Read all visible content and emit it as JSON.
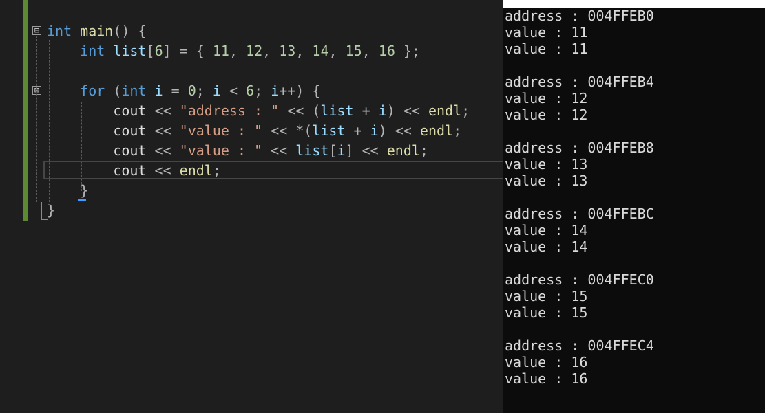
{
  "editor": {
    "lines": [
      {
        "tokens": [
          {
            "t": "int",
            "c": "kw"
          },
          {
            "t": " ",
            "c": "txt"
          },
          {
            "t": "main",
            "c": "fn"
          },
          {
            "t": "() {",
            "c": "pun"
          }
        ]
      },
      {
        "tokens": [
          {
            "t": "    ",
            "c": "txt"
          },
          {
            "t": "int",
            "c": "kw"
          },
          {
            "t": " ",
            "c": "txt"
          },
          {
            "t": "list",
            "c": "var"
          },
          {
            "t": "[",
            "c": "pun"
          },
          {
            "t": "6",
            "c": "num"
          },
          {
            "t": "] = { ",
            "c": "pun"
          },
          {
            "t": "11",
            "c": "num"
          },
          {
            "t": ", ",
            "c": "pun"
          },
          {
            "t": "12",
            "c": "num"
          },
          {
            "t": ", ",
            "c": "pun"
          },
          {
            "t": "13",
            "c": "num"
          },
          {
            "t": ", ",
            "c": "pun"
          },
          {
            "t": "14",
            "c": "num"
          },
          {
            "t": ", ",
            "c": "pun"
          },
          {
            "t": "15",
            "c": "num"
          },
          {
            "t": ", ",
            "c": "pun"
          },
          {
            "t": "16",
            "c": "num"
          },
          {
            "t": " };",
            "c": "pun"
          }
        ]
      },
      {
        "tokens": []
      },
      {
        "tokens": [
          {
            "t": "    ",
            "c": "txt"
          },
          {
            "t": "for",
            "c": "kw"
          },
          {
            "t": " (",
            "c": "pun"
          },
          {
            "t": "int",
            "c": "kw"
          },
          {
            "t": " ",
            "c": "txt"
          },
          {
            "t": "i",
            "c": "var"
          },
          {
            "t": " = ",
            "c": "pun"
          },
          {
            "t": "0",
            "c": "num"
          },
          {
            "t": "; ",
            "c": "pun"
          },
          {
            "t": "i",
            "c": "var"
          },
          {
            "t": " < ",
            "c": "pun"
          },
          {
            "t": "6",
            "c": "num"
          },
          {
            "t": "; ",
            "c": "pun"
          },
          {
            "t": "i",
            "c": "var"
          },
          {
            "t": "++) {",
            "c": "pun"
          }
        ]
      },
      {
        "tokens": [
          {
            "t": "        ",
            "c": "txt"
          },
          {
            "t": "cout",
            "c": "txt"
          },
          {
            "t": " << ",
            "c": "pun"
          },
          {
            "t": "\"address : \"",
            "c": "str"
          },
          {
            "t": " << (",
            "c": "pun"
          },
          {
            "t": "list",
            "c": "var"
          },
          {
            "t": " + ",
            "c": "pun"
          },
          {
            "t": "i",
            "c": "var"
          },
          {
            "t": ") << ",
            "c": "pun"
          },
          {
            "t": "endl",
            "c": "fn"
          },
          {
            "t": ";",
            "c": "pun"
          }
        ]
      },
      {
        "tokens": [
          {
            "t": "        ",
            "c": "txt"
          },
          {
            "t": "cout",
            "c": "txt"
          },
          {
            "t": " << ",
            "c": "pun"
          },
          {
            "t": "\"value : \"",
            "c": "str"
          },
          {
            "t": " << *(",
            "c": "pun"
          },
          {
            "t": "list",
            "c": "var"
          },
          {
            "t": " + ",
            "c": "pun"
          },
          {
            "t": "i",
            "c": "var"
          },
          {
            "t": ") << ",
            "c": "pun"
          },
          {
            "t": "endl",
            "c": "fn"
          },
          {
            "t": ";",
            "c": "pun"
          }
        ]
      },
      {
        "tokens": [
          {
            "t": "        ",
            "c": "txt"
          },
          {
            "t": "cout",
            "c": "txt"
          },
          {
            "t": " << ",
            "c": "pun"
          },
          {
            "t": "\"value : \"",
            "c": "str"
          },
          {
            "t": " << ",
            "c": "pun"
          },
          {
            "t": "list",
            "c": "var"
          },
          {
            "t": "[",
            "c": "pun"
          },
          {
            "t": "i",
            "c": "var"
          },
          {
            "t": "] << ",
            "c": "pun"
          },
          {
            "t": "endl",
            "c": "fn"
          },
          {
            "t": ";",
            "c": "pun"
          }
        ]
      },
      {
        "tokens": [
          {
            "t": "        ",
            "c": "txt"
          },
          {
            "t": "cout",
            "c": "txt"
          },
          {
            "t": " << ",
            "c": "pun"
          },
          {
            "t": "endl",
            "c": "fn"
          },
          {
            "t": ";",
            "c": "pun"
          }
        ]
      },
      {
        "tokens": [
          {
            "t": "    ",
            "c": "txt"
          },
          {
            "t": "}",
            "c": "pun"
          }
        ]
      },
      {
        "tokens": [
          {
            "t": "}",
            "c": "pun"
          }
        ]
      }
    ],
    "fold_markers": [
      "⊟",
      "⊟"
    ]
  },
  "console": {
    "blocks": [
      {
        "address": "address : 004FFEB0",
        "value1": "value : 11",
        "value2": "value : 11"
      },
      {
        "address": "address : 004FFEB4",
        "value1": "value : 12",
        "value2": "value : 12"
      },
      {
        "address": "address : 004FFEB8",
        "value1": "value : 13",
        "value2": "value : 13"
      },
      {
        "address": "address : 004FFEBC",
        "value1": "value : 14",
        "value2": "value : 14"
      },
      {
        "address": "address : 004FFEC0",
        "value1": "value : 15",
        "value2": "value : 15"
      },
      {
        "address": "address : 004FFEC4",
        "value1": "value : 16",
        "value2": "value : 16"
      }
    ]
  },
  "colors": {
    "editor_bg": "#1e1e1e",
    "console_bg": "#0c0c0c",
    "keyword": "#569cd6",
    "function": "#dcdcaa",
    "variable": "#9cdcfe",
    "number": "#b5cea8",
    "string": "#d69d85",
    "change_bar": "#5b8a32"
  }
}
